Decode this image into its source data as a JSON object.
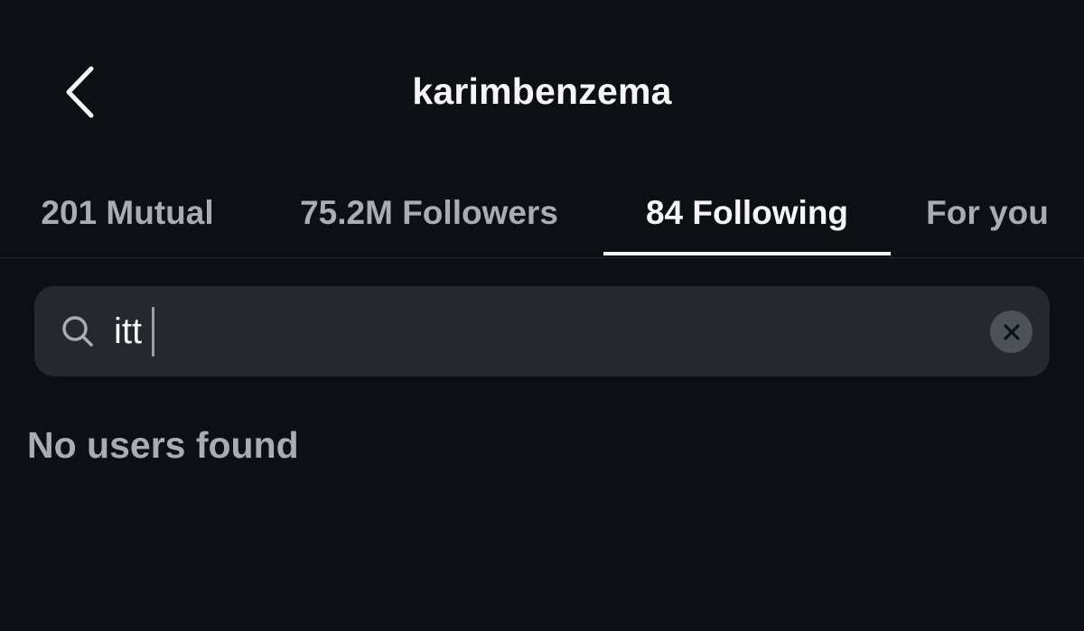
{
  "header": {
    "title": "karimbenzema",
    "back_icon": "chevron-left-icon"
  },
  "tabs": [
    {
      "label": "201 Mutual",
      "active": false
    },
    {
      "label": "75.2M Followers",
      "active": false
    },
    {
      "label": "84 Following",
      "active": true
    },
    {
      "label": "For you",
      "active": false
    }
  ],
  "search": {
    "value": "itt",
    "icon": "search-icon",
    "clear_icon": "close-icon"
  },
  "results": {
    "empty_message": "No users found"
  },
  "colors": {
    "background": "#0c1014",
    "primary_text": "#f5f5f5",
    "secondary_text": "#a8acb3",
    "search_bg": "#25292e"
  }
}
